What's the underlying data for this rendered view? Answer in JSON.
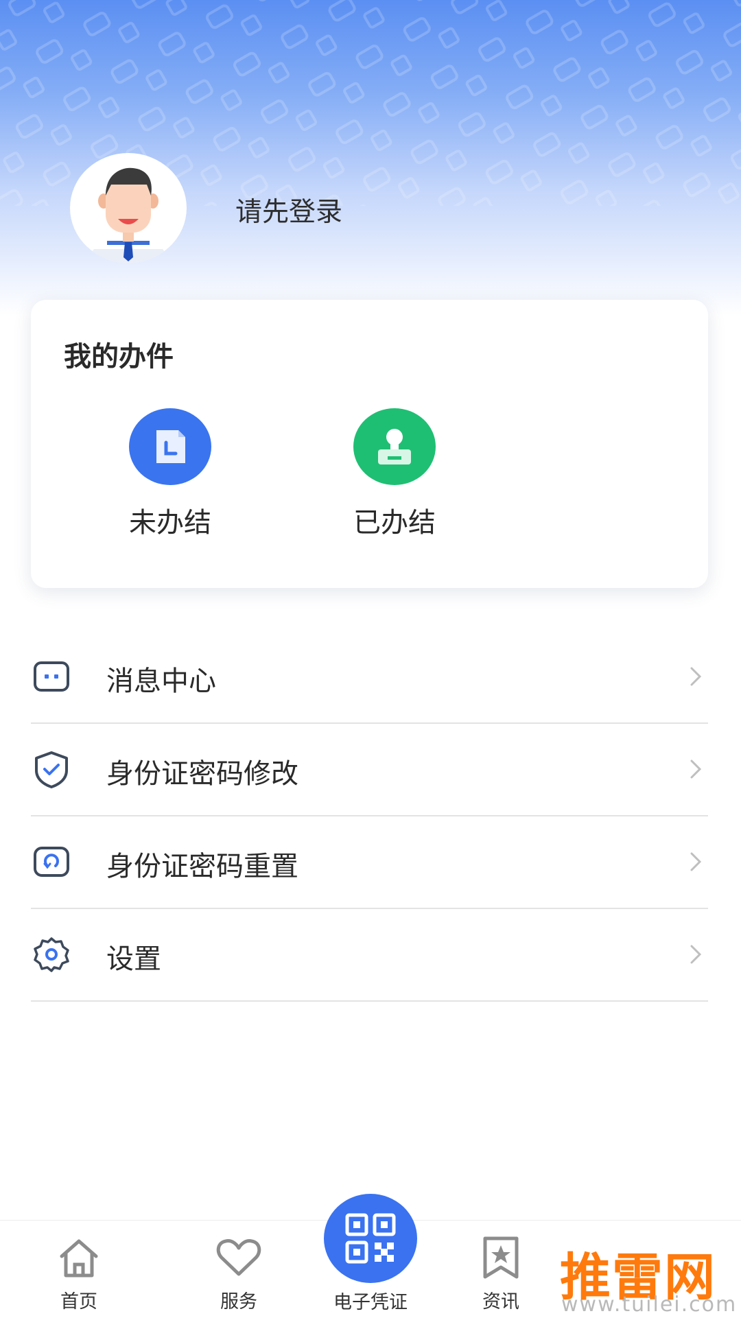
{
  "profile": {
    "login_prompt": "请先登录",
    "avatar_icon": "user-avatar-icon"
  },
  "tasks": {
    "title": "我的办件",
    "items": [
      {
        "label": "未办结",
        "icon": "document-clock-icon",
        "color": "#3a74ef"
      },
      {
        "label": "已办结",
        "icon": "stamp-icon",
        "color": "#1fbf73"
      }
    ]
  },
  "menu": {
    "items": [
      {
        "label": "消息中心",
        "icon": "message-icon"
      },
      {
        "label": "身份证密码修改",
        "icon": "shield-check-icon"
      },
      {
        "label": "身份证密码重置",
        "icon": "reset-icon"
      },
      {
        "label": "设置",
        "icon": "gear-icon"
      }
    ]
  },
  "tabbar": {
    "items": [
      {
        "label": "首页",
        "icon": "home-icon"
      },
      {
        "label": "服务",
        "icon": "heart-icon"
      },
      {
        "label": "电子凭证",
        "icon": "qr-code-icon"
      },
      {
        "label": "资讯",
        "icon": "bookmark-star-icon"
      }
    ]
  },
  "watermark": {
    "main": "推雷网",
    "sub": "www.tuilei.com"
  },
  "colors": {
    "accent": "#3a72f0",
    "header_top": "#5b8ff2",
    "success": "#1fbf73",
    "watermark": "#ff7a0c"
  }
}
